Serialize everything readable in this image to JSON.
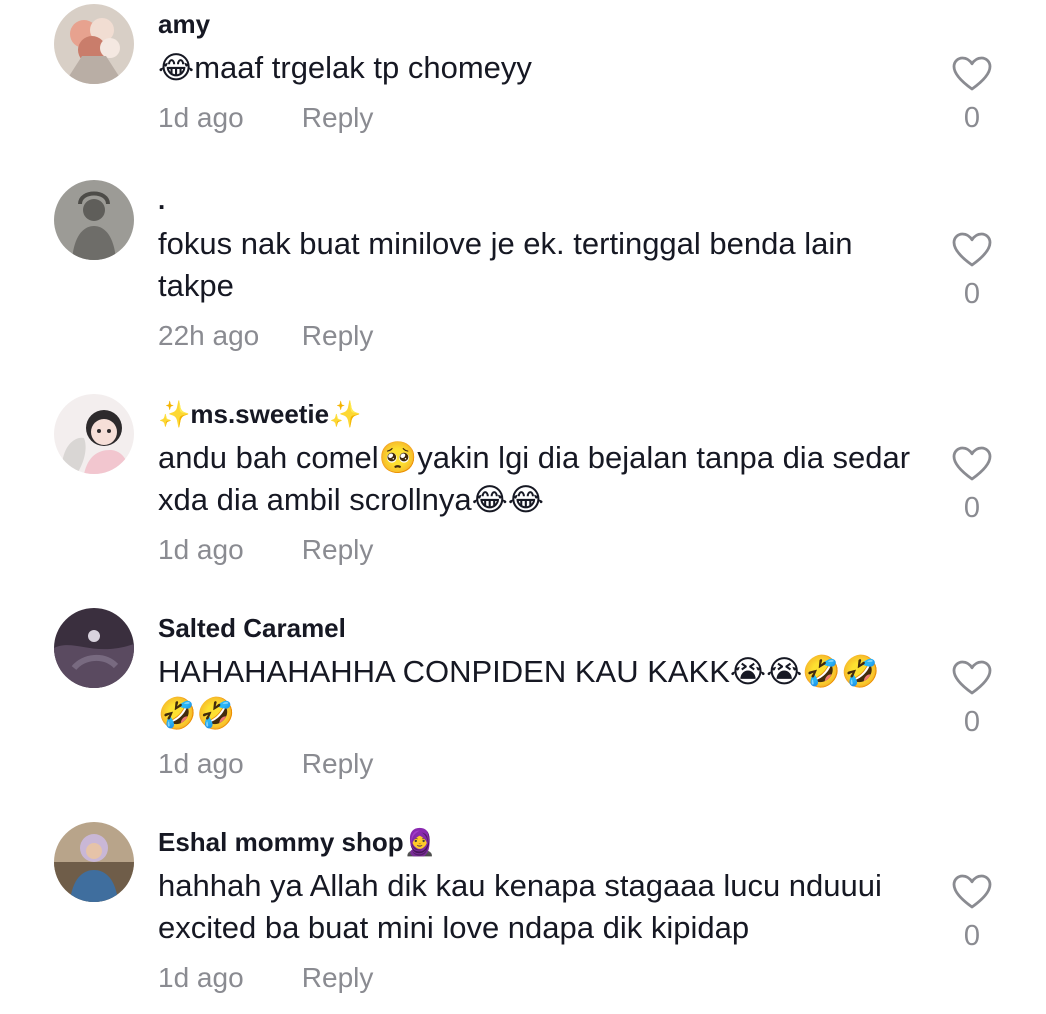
{
  "comments": [
    {
      "username": "amy",
      "text": "😂maaf trgelak tp chomeyy",
      "time": "1d ago",
      "reply_label": "Reply",
      "likes": "0"
    },
    {
      "username": ".",
      "text": "fokus nak buat minilove je ek. tertinggal benda lain takpe",
      "time": "22h ago",
      "reply_label": "Reply",
      "likes": "0"
    },
    {
      "username": "✨ms.sweetie✨",
      "text": "andu bah comel🥺yakin lgi dia bejalan tanpa dia sedar xda dia ambil scrollnya😂😂",
      "time": "1d ago",
      "reply_label": "Reply",
      "likes": "0"
    },
    {
      "username": "Salted Caramel",
      "text": "HAHAHAHAHHA CONPIDEN KAU KAKK😭😭🤣🤣🤣🤣",
      "time": "1d ago",
      "reply_label": "Reply",
      "likes": "0"
    },
    {
      "username": "Eshal mommy shop🧕",
      "text": "hahhah ya Allah dik kau kenapa stagaaa lucu nduuui excited ba buat mini love ndapa dik kipidap",
      "time": "1d ago",
      "reply_label": "Reply",
      "likes": "0"
    }
  ],
  "icons": {
    "like": "heart-outline-icon"
  },
  "colors": {
    "primary_text": "#161823",
    "secondary_text": "#8a8b91",
    "background": "#ffffff"
  }
}
